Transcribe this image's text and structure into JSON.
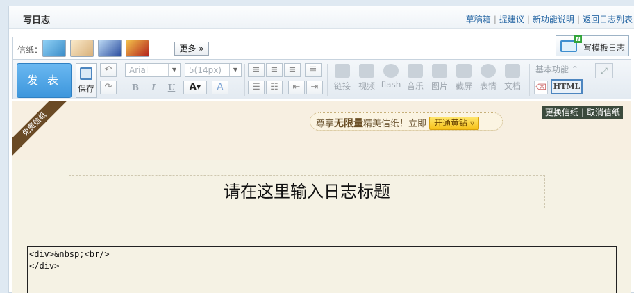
{
  "header": {
    "title": "写日志",
    "links": [
      "草稿箱",
      "提建议",
      "新功能说明",
      "返回日志列表"
    ]
  },
  "paper": {
    "label": "信纸：",
    "more_label": "更多 »",
    "thumb_colors": [
      "#4b9fd6",
      "#f2d9a8",
      "#3d63b8",
      "#c8302a"
    ]
  },
  "template_button": {
    "label": "写模板日志",
    "badge": "N"
  },
  "toolbar": {
    "publish_label": "发 表",
    "save_label": "保存",
    "font_family": "Arial",
    "font_size": "5(14px)",
    "tools": [
      "链接",
      "视频",
      "flash",
      "音乐",
      "图片",
      "截屏",
      "表情",
      "文档"
    ],
    "basic_label": "基本功能 ⌃",
    "html_label": "HTML"
  },
  "banner": {
    "ribbon": "免费信纸",
    "enjoy_prefix": "尊享",
    "enjoy_bold": "无限量",
    "enjoy_suffix": "精美信纸！立即",
    "vip_button": "开通黄钻",
    "switch_label": "更换信纸",
    "cancel_label": "取消信纸"
  },
  "editor": {
    "title_placeholder": "请在这里输入日志标题",
    "html_source": "<div>&nbsp;<br/>\n</div>"
  }
}
